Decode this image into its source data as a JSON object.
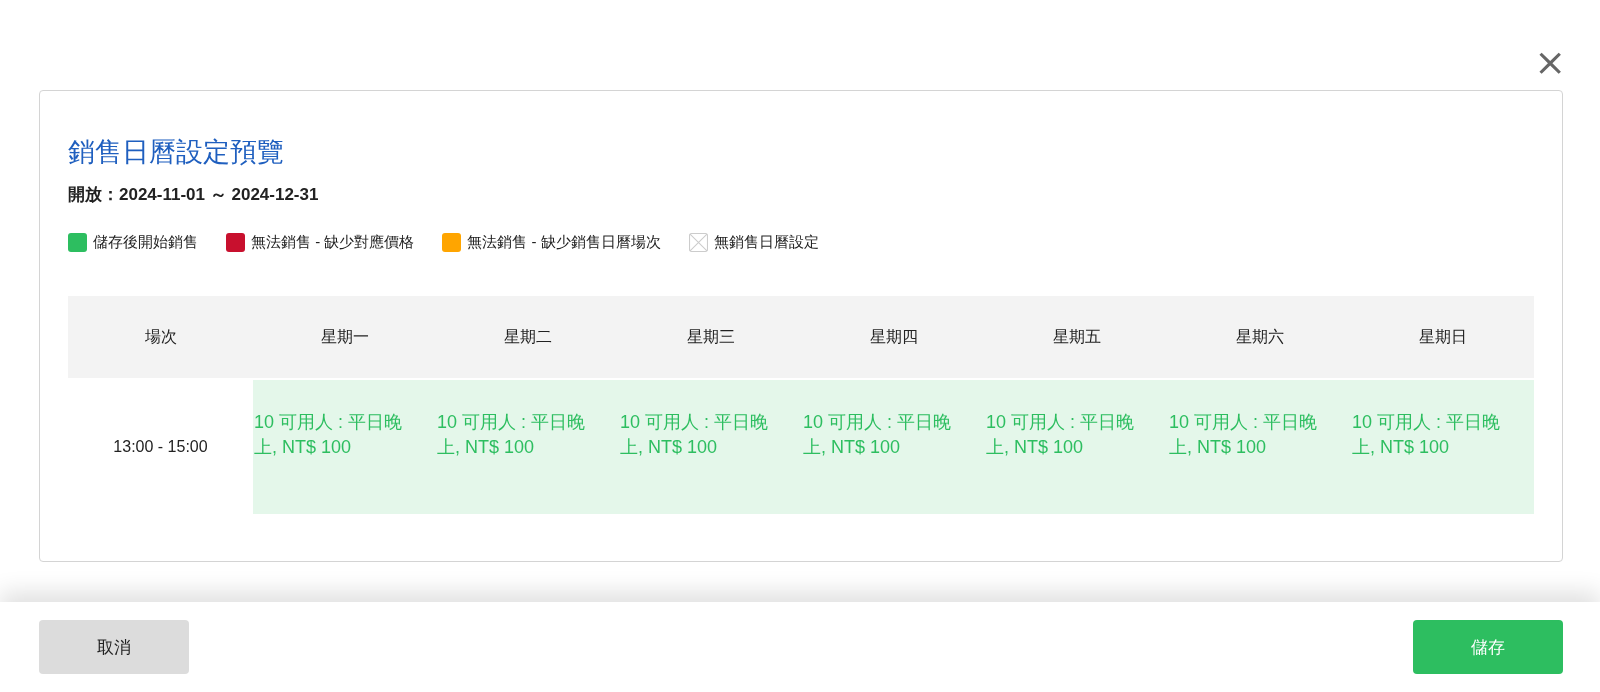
{
  "close_label": "×",
  "title": "銷售日曆設定預覽",
  "open_period": {
    "label": "開放：",
    "range": "2024-11-01 ～ 2024-12-31"
  },
  "legend": [
    {
      "kind": "swatch",
      "color": "#2dbe60",
      "label": "儲存後開始銷售"
    },
    {
      "kind": "swatch",
      "color": "#c8102e",
      "label": "無法銷售 - 缺少對應價格"
    },
    {
      "kind": "swatch",
      "color": "#ffa500",
      "label": "無法銷售 - 缺少銷售日曆場次"
    },
    {
      "kind": "empty",
      "label": "無銷售日曆設定"
    }
  ],
  "table": {
    "columns": [
      "場次",
      "星期一",
      "星期二",
      "星期三",
      "星期四",
      "星期五",
      "星期六",
      "星期日"
    ],
    "rows": [
      {
        "cells": [
          {
            "text": "13:00 - 15:00"
          },
          {
            "color": "#2dbe60",
            "text": "10 可用人 : 平日晚上, NT$ 100"
          },
          {
            "color": "#2dbe60",
            "text": "10 可用人 : 平日晚上, NT$ 100"
          },
          {
            "color": "#2dbe60",
            "text": "10 可用人 : 平日晚上, NT$ 100"
          },
          {
            "color": "#2dbe60",
            "text": "10 可用人 : 平日晚上, NT$ 100"
          },
          {
            "color": "#2dbe60",
            "text": "10 可用人 : 平日晚上, NT$ 100"
          },
          {
            "color": "#2dbe60",
            "text": "10 可用人 : 平日晚上, NT$ 100"
          },
          {
            "color": "#2dbe60",
            "text": "10 可用人 : 平日晚上, NT$ 100"
          }
        ]
      }
    ]
  },
  "buttons": {
    "cancel": "取消",
    "save": "儲存"
  }
}
